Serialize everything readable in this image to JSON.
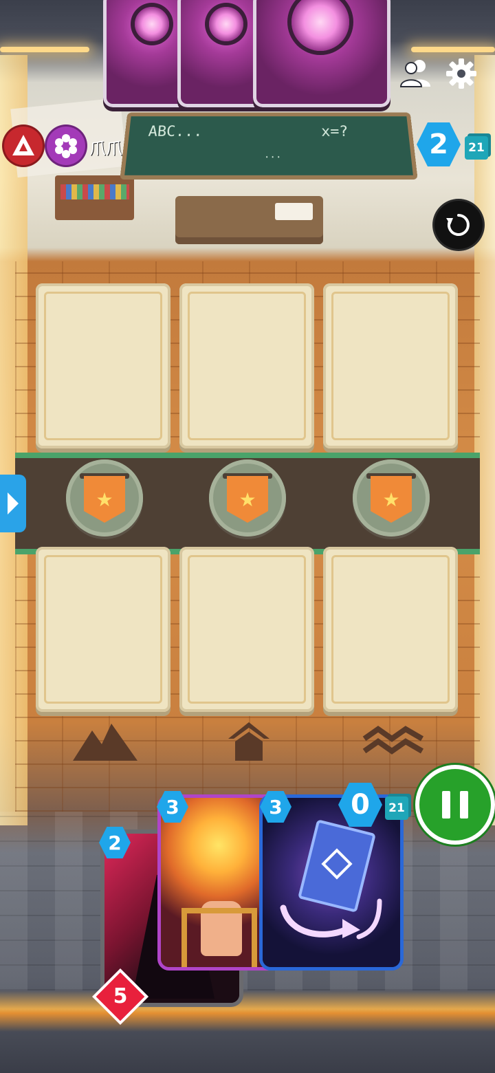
{
  "hud": {
    "opponent_name": "爪爪",
    "opponent_energy": "2",
    "opponent_deck_count": "21",
    "player_energy": "0",
    "player_deck_count": "21"
  },
  "board": {
    "chalkboard_left": "ABC...",
    "chalkboard_right": "x=?",
    "chalkboard_bottom": "..."
  },
  "hand": [
    {
      "cost": "2",
      "power": "5"
    },
    {
      "cost": "3"
    },
    {
      "cost": "3"
    }
  ],
  "colors": {
    "energy": "#1fa6ea",
    "pause": "#27a12a",
    "power": "#e8203c",
    "opponent_card": "#7b2e73"
  },
  "icons": [
    "friends-icon",
    "settings-icon",
    "undo-icon",
    "pause-icon",
    "expand-arrow-icon",
    "star-banner-icon",
    "mountain-icon",
    "house-icon",
    "waves-icon"
  ]
}
